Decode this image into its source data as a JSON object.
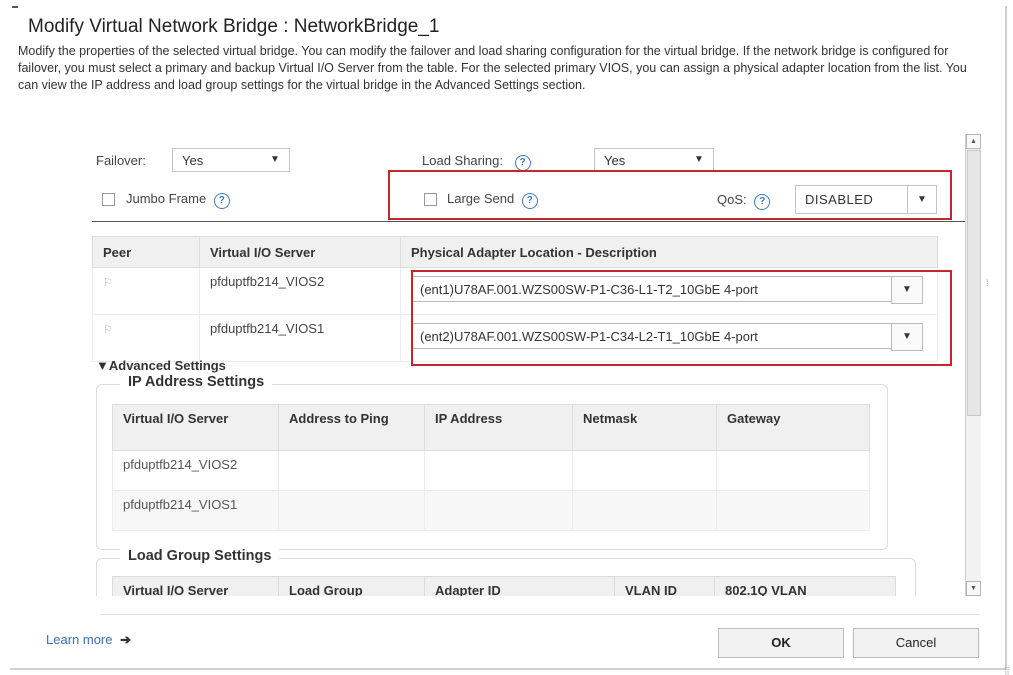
{
  "dialog": {
    "title": "Modify Virtual Network Bridge : NetworkBridge_1",
    "description": "Modify the properties of the selected virtual bridge. You can modify the failover and load sharing configuration for the virtual bridge. If the network bridge is configured for failover, you must select a primary and backup Virtual I/O Server from the table. For the selected primary VIOS, you can assign a physical adapter location from the list. You can view the IP address and load group settings for the virtual bridge in the Advanced Settings section."
  },
  "settings": {
    "failover_label": "Failover:",
    "failover_value": "Yes",
    "load_sharing_label": "Load Sharing:",
    "load_sharing_value": "Yes",
    "jumbo_frame_label": "Jumbo Frame",
    "large_send_label": "Large Send",
    "qos_label": "QoS:",
    "qos_value": "DISABLED",
    "help_glyph": "?"
  },
  "peer_table": {
    "headers": [
      "Peer",
      "Virtual I/O Server",
      "Physical Adapter Location - Description"
    ],
    "rows": [
      {
        "vios": "pfduptfb214_VIOS2",
        "adapter": "(ent1)U78AF.001.WZS00SW-P1-C36-L1-T2_10GbE 4-port"
      },
      {
        "vios": "pfduptfb214_VIOS1",
        "adapter": "(ent2)U78AF.001.WZS00SW-P1-C34-L2-T1_10GbE 4-port"
      }
    ]
  },
  "advanced": {
    "label": "▼Advanced Settings",
    "ip_legend": "IP Address Settings",
    "ip_headers": [
      "Virtual I/O Server",
      "Address to Ping",
      "IP Address",
      "Netmask",
      "Gateway"
    ],
    "ip_rows": [
      {
        "vios": "pfduptfb214_VIOS2"
      },
      {
        "vios": "pfduptfb214_VIOS1"
      }
    ],
    "load_group_legend": "Load Group Settings",
    "lg_headers": [
      "Virtual I/O Server",
      "Load Group",
      "Adapter ID",
      "VLAN ID",
      "802.1Q VLAN"
    ]
  },
  "footer": {
    "learn_more": "Learn more",
    "ok": "OK",
    "cancel": "Cancel"
  },
  "colors": {
    "highlight_box": "#c1272d",
    "link": "#3b6fb6"
  }
}
